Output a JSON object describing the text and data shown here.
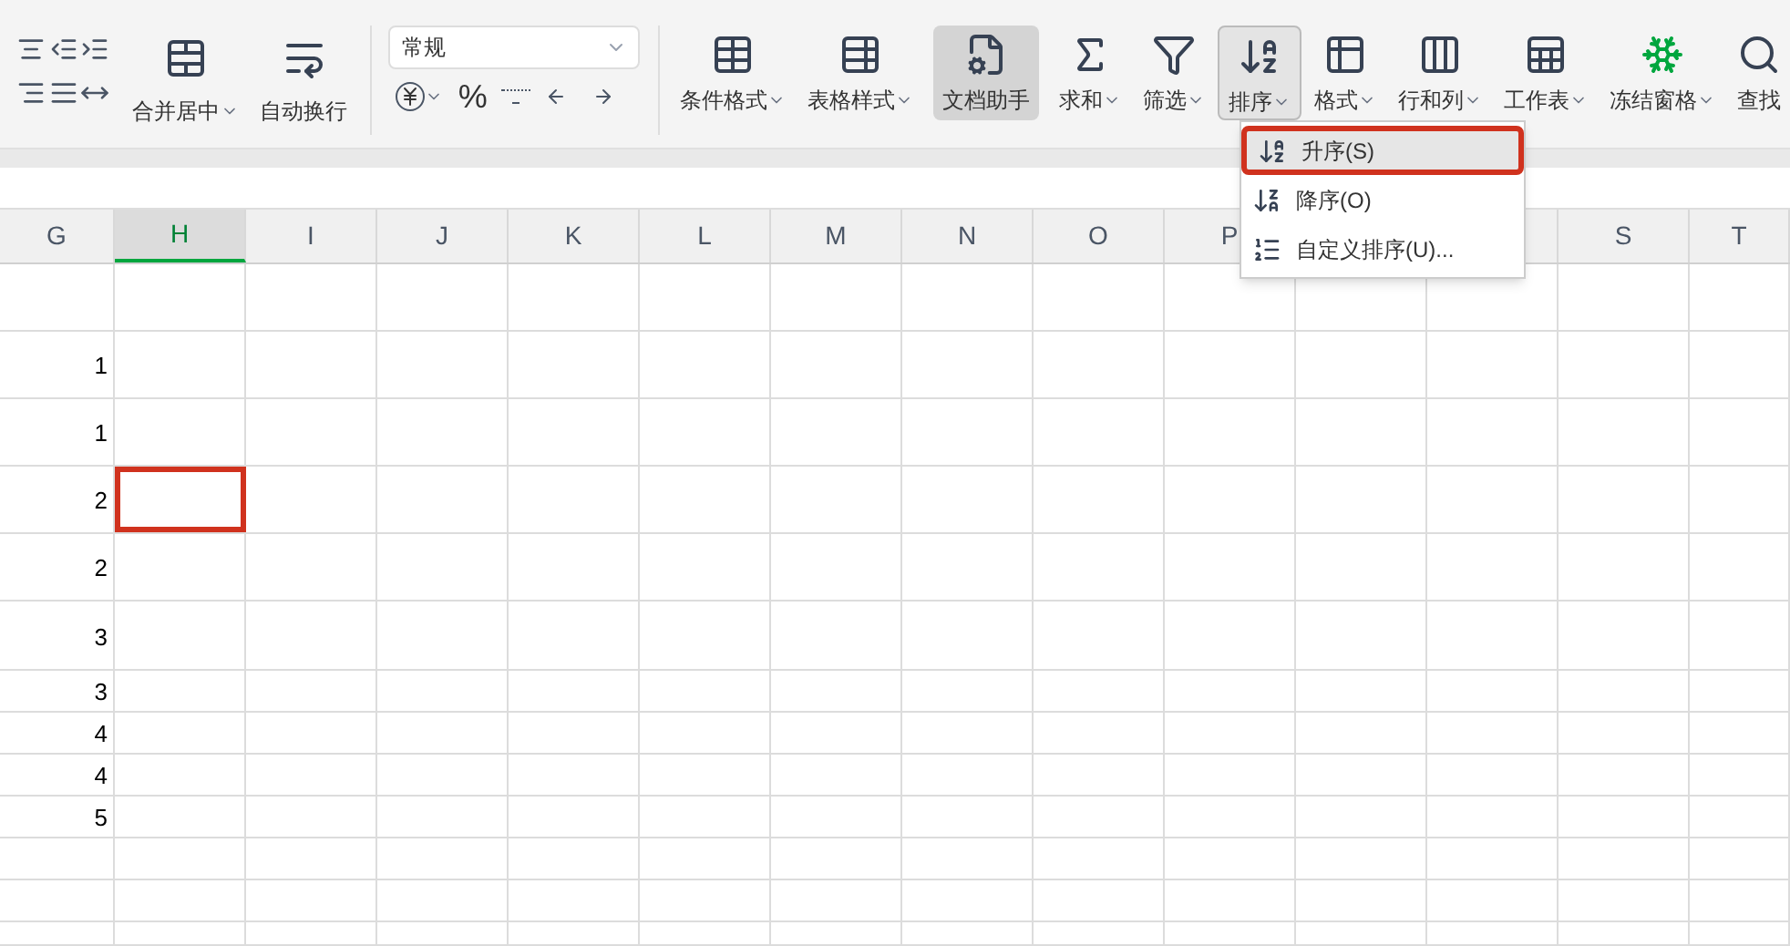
{
  "ribbon": {
    "merge_buttons": [
      {
        "label": "合并居中",
        "dropdown": true
      },
      {
        "label": "自动换行",
        "dropdown": false
      }
    ],
    "number_format": {
      "value": "常规"
    },
    "percent": "%",
    "tool_buttons": [
      {
        "label": "条件格式",
        "dropdown": true,
        "active": false,
        "open": false
      },
      {
        "label": "表格样式",
        "dropdown": true,
        "active": false,
        "open": false
      },
      {
        "label": "文档助手",
        "dropdown": false,
        "active": true,
        "open": false
      },
      {
        "label": "求和",
        "dropdown": true,
        "active": false,
        "open": false
      },
      {
        "label": "筛选",
        "dropdown": true,
        "active": false,
        "open": false
      },
      {
        "label": "排序",
        "dropdown": true,
        "active": false,
        "open": true
      },
      {
        "label": "格式",
        "dropdown": true,
        "active": false,
        "open": false
      },
      {
        "label": "行和列",
        "dropdown": true,
        "active": false,
        "open": false
      },
      {
        "label": "工作表",
        "dropdown": true,
        "active": false,
        "open": false
      },
      {
        "label": "冻结窗格",
        "dropdown": true,
        "active": false,
        "open": false
      },
      {
        "label": "查找",
        "dropdown": false,
        "active": false,
        "open": false
      }
    ]
  },
  "sort_menu": [
    {
      "label": "升序(S)",
      "selected": true
    },
    {
      "label": "降序(O)",
      "selected": false
    },
    {
      "label": "自定义排序(U)...",
      "selected": false
    }
  ],
  "columns": [
    {
      "label": "G",
      "selected": false
    },
    {
      "label": "H",
      "selected": true
    },
    {
      "label": "I",
      "selected": false
    },
    {
      "label": "J",
      "selected": false
    },
    {
      "label": "K",
      "selected": false
    },
    {
      "label": "L",
      "selected": false
    },
    {
      "label": "M",
      "selected": false
    },
    {
      "label": "N",
      "selected": false
    },
    {
      "label": "O",
      "selected": false
    },
    {
      "label": "P",
      "selected": false
    },
    {},
    {},
    {
      "label": "S",
      "selected": false
    },
    {
      "label": "T",
      "selected": false
    }
  ],
  "rows": [
    {
      "selected": false
    },
    {
      "value": "1",
      "selected": false
    },
    {
      "value": "1",
      "selected": false
    },
    {
      "value": "2",
      "selected": true
    },
    {
      "value": "2",
      "selected": false
    },
    {
      "value": "3",
      "selected": false
    },
    {
      "value": "3",
      "selected": false
    },
    {
      "value": "4",
      "selected": false
    },
    {
      "value": "4",
      "selected": false
    },
    {
      "value": "5",
      "selected": false
    },
    {
      "selected": false
    },
    {
      "selected": false
    },
    {
      "selected": false
    }
  ]
}
